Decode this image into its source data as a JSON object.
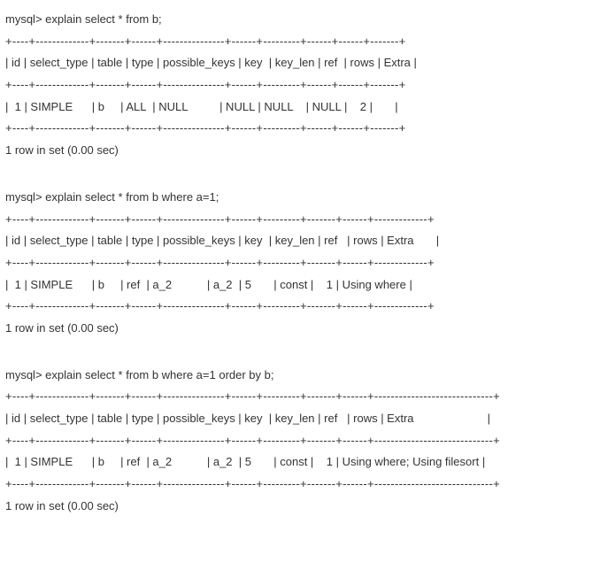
{
  "queries": [
    {
      "prompt": "mysql> explain select * from b;",
      "sep": "+----+-------------+-------+------+---------------+------+---------+------+------+-------+",
      "header": "| id | select_type | table | type | possible_keys | key  | key_len | ref  | rows | Extra |",
      "row": "|  1 | SIMPLE      | b     | ALL  | NULL          | NULL | NULL    | NULL |    2 |       |",
      "footer": "1 row in set (0.00 sec)"
    },
    {
      "prompt": "mysql> explain select * from b where a=1;",
      "sep": "+----+-------------+-------+------+---------------+------+---------+-------+------+-------------+",
      "header": "| id | select_type | table | type | possible_keys | key  | key_len | ref   | rows | Extra       |",
      "row": "|  1 | SIMPLE      | b     | ref  | a_2           | a_2  | 5       | const |    1 | Using where |",
      "footer": "1 row in set (0.00 sec)"
    },
    {
      "prompt": "mysql> explain select * from b where a=1 order by b;",
      "sep": "+----+-------------+-------+------+---------------+------+---------+-------+------+-----------------------------+",
      "header": "| id | select_type | table | type | possible_keys | key  | key_len | ref   | rows | Extra                       |",
      "row": "|  1 | SIMPLE      | b     | ref  | a_2           | a_2  | 5       | const |    1 | Using where; Using filesort |",
      "footer": "1 row in set (0.00 sec)"
    }
  ],
  "chart_data": [
    {
      "type": "table",
      "title": "explain select * from b",
      "columns": [
        "id",
        "select_type",
        "table",
        "type",
        "possible_keys",
        "key",
        "key_len",
        "ref",
        "rows",
        "Extra"
      ],
      "rows": [
        [
          "1",
          "SIMPLE",
          "b",
          "ALL",
          "NULL",
          "NULL",
          "NULL",
          "NULL",
          "2",
          ""
        ]
      ]
    },
    {
      "type": "table",
      "title": "explain select * from b where a=1",
      "columns": [
        "id",
        "select_type",
        "table",
        "type",
        "possible_keys",
        "key",
        "key_len",
        "ref",
        "rows",
        "Extra"
      ],
      "rows": [
        [
          "1",
          "SIMPLE",
          "b",
          "ref",
          "a_2",
          "a_2",
          "5",
          "const",
          "1",
          "Using where"
        ]
      ]
    },
    {
      "type": "table",
      "title": "explain select * from b where a=1 order by b",
      "columns": [
        "id",
        "select_type",
        "table",
        "type",
        "possible_keys",
        "key",
        "key_len",
        "ref",
        "rows",
        "Extra"
      ],
      "rows": [
        [
          "1",
          "SIMPLE",
          "b",
          "ref",
          "a_2",
          "a_2",
          "5",
          "const",
          "1",
          "Using where; Using filesort"
        ]
      ]
    }
  ]
}
